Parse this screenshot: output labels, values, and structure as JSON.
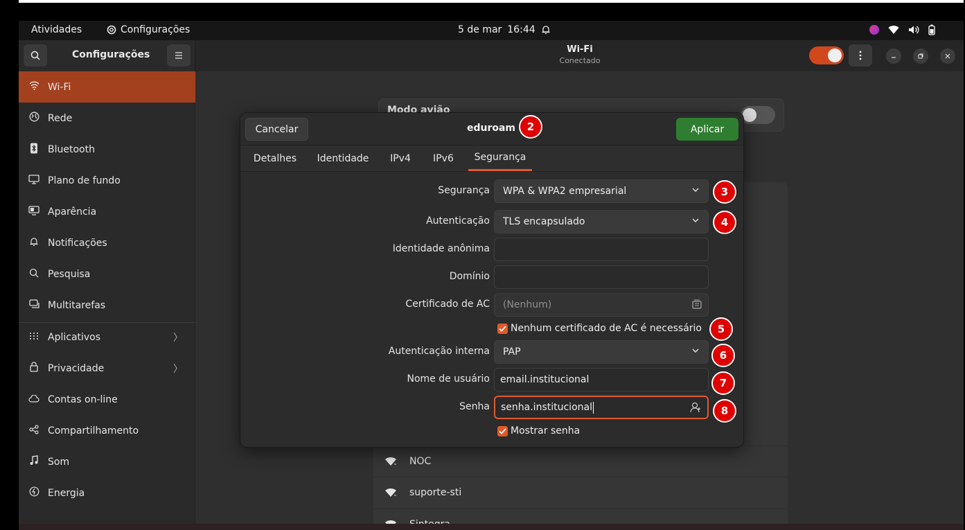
{
  "topbar": {
    "activities": "Atividades",
    "app_name": "Configurações",
    "date": "5 de mar",
    "time": "16:44"
  },
  "header": {
    "sidebar_title": "Configurações",
    "page_title": "Wi-Fi",
    "page_subtitle": "Conectado",
    "wifi_enabled": true
  },
  "sidebar": {
    "items": [
      {
        "label": "Wi-Fi",
        "icon": "wifi-icon"
      },
      {
        "label": "Rede",
        "icon": "network-icon"
      },
      {
        "label": "Bluetooth",
        "icon": "bluetooth-icon"
      },
      {
        "label": "Plano de fundo",
        "icon": "wallpaper-icon"
      },
      {
        "label": "Aparência",
        "icon": "appearance-icon"
      },
      {
        "label": "Notificações",
        "icon": "bell-icon"
      },
      {
        "label": "Pesquisa",
        "icon": "search-icon"
      },
      {
        "label": "Multitarefas",
        "icon": "multitask-icon"
      },
      {
        "label": "Aplicativos",
        "icon": "apps-icon"
      },
      {
        "label": "Privacidade",
        "icon": "lock-icon"
      },
      {
        "label": "Contas on-line",
        "icon": "cloud-icon"
      },
      {
        "label": "Compartilhamento",
        "icon": "share-icon"
      },
      {
        "label": "Som",
        "icon": "music-icon"
      },
      {
        "label": "Energia",
        "icon": "power-icon"
      }
    ]
  },
  "main": {
    "airplane_label": "Modo avião",
    "networks": [
      "NOC",
      "suporte-sti",
      "Sintegra"
    ]
  },
  "dialog": {
    "cancel": "Cancelar",
    "title": "eduroam",
    "apply": "Aplicar",
    "tabs": [
      "Detalhes",
      "Identidade",
      "IPv4",
      "IPv6",
      "Segurança"
    ],
    "active_tab": "Segurança",
    "form": {
      "security_label": "Segurança",
      "security_value": "WPA & WPA2 empresarial",
      "auth_label": "Autenticação",
      "auth_value": "TLS encapsulado",
      "anon_identity_label": "Identidade anônima",
      "anon_identity_value": "",
      "domain_label": "Domínio",
      "domain_value": "",
      "ca_cert_label": "Certificado de AC",
      "ca_cert_placeholder": "(Nenhum)",
      "no_ca_check_label": "Nenhum certificado de AC é necessário",
      "no_ca_checked": true,
      "inner_auth_label": "Autenticação interna",
      "inner_auth_value": "PAP",
      "username_label": "Nome de usuário",
      "username_value": "email.institucional",
      "password_label": "Senha",
      "password_value": "senha.institucional",
      "show_password_label": "Mostrar senha",
      "show_password_checked": true
    }
  },
  "annotations": [
    "2",
    "3",
    "4",
    "5",
    "6",
    "7",
    "8"
  ],
  "colors": {
    "accent": "#e1592b",
    "sidebar_active": "#a3401e",
    "apply": "#2f7d31",
    "badge": "#e00000"
  }
}
